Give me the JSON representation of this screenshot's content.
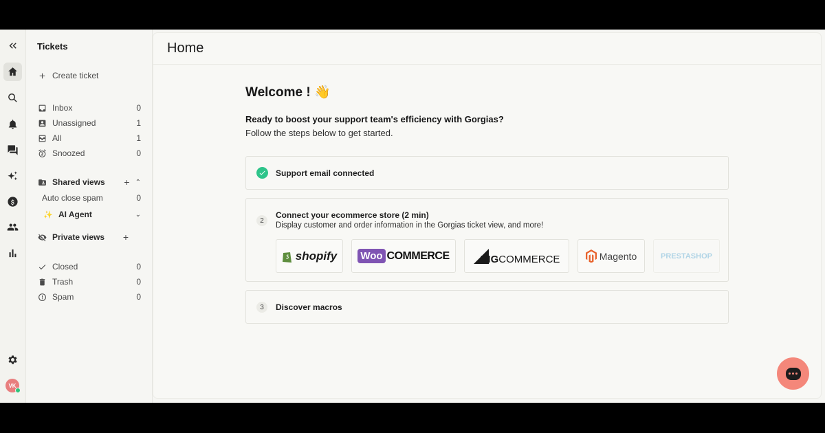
{
  "sidebar": {
    "title": "Tickets",
    "create_label": "Create ticket",
    "items": [
      {
        "label": "Inbox",
        "count": "0"
      },
      {
        "label": "Unassigned",
        "count": "1"
      },
      {
        "label": "All",
        "count": "1"
      },
      {
        "label": "Snoozed",
        "count": "0"
      }
    ],
    "shared_views_label": "Shared views",
    "shared_items": [
      {
        "label": "Auto close spam",
        "count": "0"
      },
      {
        "label": "AI Agent"
      }
    ],
    "private_views_label": "Private views",
    "bottom_items": [
      {
        "label": "Closed",
        "count": "0"
      },
      {
        "label": "Trash",
        "count": "0"
      },
      {
        "label": "Spam",
        "count": "0"
      }
    ]
  },
  "rail": {
    "avatar_initials": "VK"
  },
  "main": {
    "title": "Home",
    "welcome": "Welcome !",
    "welcome_emoji": "👋",
    "intro_bold": "Ready to boost your support team's efficiency with Gorgias?",
    "intro_text": "Follow the steps below to get started.",
    "steps": [
      {
        "title": "Support email connected"
      },
      {
        "number": "2",
        "title": "Connect your ecommerce store (2 min)",
        "desc": "Display customer and order information in the Gorgias ticket view, and more!"
      },
      {
        "number": "3",
        "title": "Discover macros"
      }
    ],
    "logos": {
      "shopify": "shopify",
      "woo_badge": "Woo",
      "woo_text": "COMMERCE",
      "big_prefix": "BIG",
      "big_text": "COMMERCE",
      "magento": "Magento",
      "presta": "PRESTASHOP"
    }
  },
  "colors": {
    "accent_check": "#2ec48a",
    "chat": "#f4877a",
    "woo": "#7f54b3",
    "magento": "#e8622c",
    "shopify": "#5e8e3e"
  }
}
